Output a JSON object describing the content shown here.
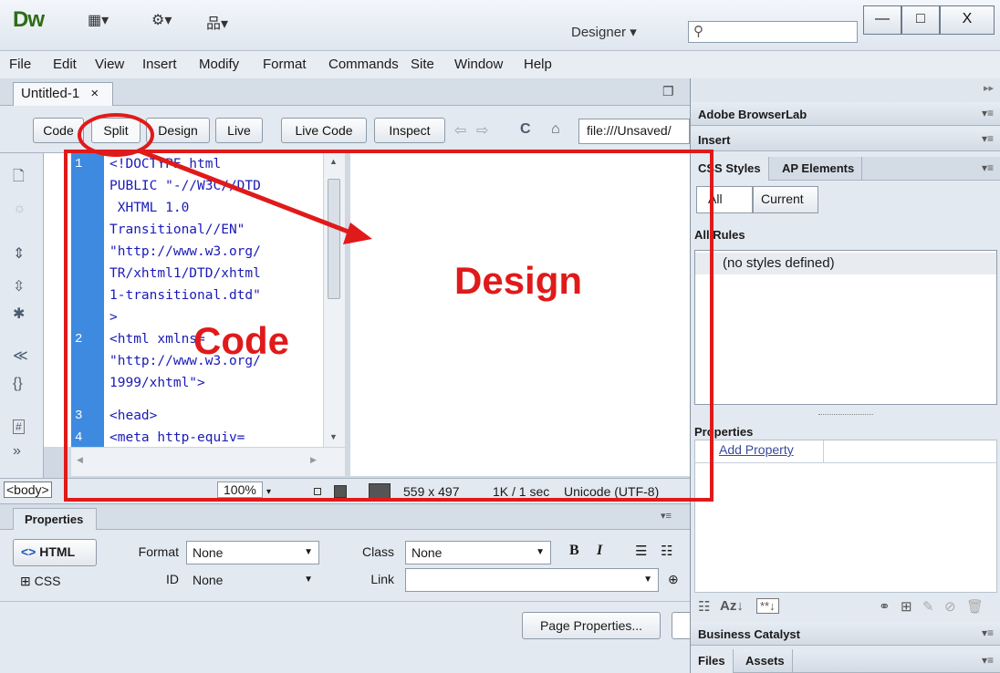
{
  "app": {
    "logo": "Dw",
    "toolbar_icons": [
      "▦▾",
      "⚙▾",
      "品▾"
    ],
    "workspace": "Designer ▾",
    "search_icon_glyph": "⚲",
    "window_controls": {
      "minimize": "—",
      "maximize": "□",
      "close": "X"
    }
  },
  "menu": [
    "File",
    "Edit",
    "View",
    "Insert",
    "Modify",
    "Format",
    "Commands",
    "Site",
    "Window",
    "Help"
  ],
  "document": {
    "tab_label": "Untitled-1",
    "tab_close": "×"
  },
  "view_toolbar": {
    "code": "Code",
    "split": "Split",
    "design": "Design",
    "live": "Live",
    "live_code": "Live Code",
    "inspect": "Inspect",
    "address": "file:///Unsaved/"
  },
  "code_lines": [
    {
      "num": "1",
      "text": "<!DOCTYPE html"
    },
    {
      "num": "",
      "text": "PUBLIC \"-//W3C//DTD"
    },
    {
      "num": "",
      "text": " XHTML 1.0"
    },
    {
      "num": "",
      "text": "Transitional//EN\""
    },
    {
      "num": "",
      "text": "\"http://www.w3.org/"
    },
    {
      "num": "",
      "text": "TR/xhtml1/DTD/xhtml"
    },
    {
      "num": "",
      "text": "1-transitional.dtd\""
    },
    {
      "num": "",
      "text": ">"
    },
    {
      "num": "2",
      "text": "<html xmlns="
    },
    {
      "num": "",
      "text": "\"http://www.w3.org/"
    },
    {
      "num": "",
      "text": "1999/xhtml\">"
    },
    {
      "num": "3",
      "text": "<head>"
    },
    {
      "num": "4",
      "text": "<meta http-equiv="
    }
  ],
  "status": {
    "tag": "<body>",
    "zoom": "100%",
    "dimensions": "559 x 497",
    "download": "1K / 1 sec",
    "encoding": "Unicode (UTF-8)"
  },
  "properties": {
    "tab": "Properties",
    "html_btn": "HTML",
    "css_btn": "CSS",
    "format_label": "Format",
    "format_value": "None",
    "id_label": "ID",
    "id_value": "None",
    "class_label": "Class",
    "class_value": "None",
    "link_label": "Link",
    "link_value": "",
    "bold": "B",
    "italic": "I",
    "page_properties": "Page Properties..."
  },
  "right": {
    "browserlab": "Adobe BrowserLab",
    "insert": "Insert",
    "css_styles": "CSS Styles",
    "ap_elements": "AP Elements",
    "all": "All",
    "current": "Current",
    "all_rules": "All Rules",
    "no_styles": "(no styles defined)",
    "properties": "Properties",
    "add_property": "Add Property",
    "business_catalyst": "Business Catalyst",
    "files": "Files",
    "assets": "Assets"
  },
  "annotations": {
    "code": "Code",
    "design": "Design"
  }
}
